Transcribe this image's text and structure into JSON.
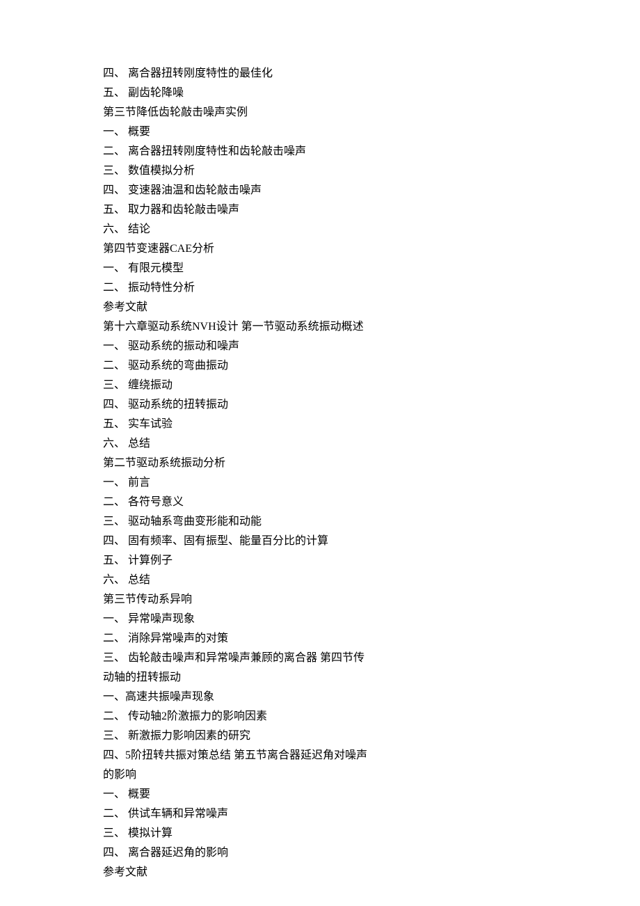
{
  "lines": [
    "四、 离合器扭转刚度特性的最佳化",
    "五、 副齿轮降噪",
    "第三节降低齿轮敲击噪声实例",
    "一、 概要",
    "二、 离合器扭转刚度特性和齿轮敲击噪声",
    "三、 数值模拟分析",
    "四、 变速器油温和齿轮敲击噪声",
    "五、 取力器和齿轮敲击噪声",
    "六、 结论",
    "第四节变速器CAE分析",
    "一、 有限元模型",
    "二、 振动特性分析",
    "参考文献",
    "第十六章驱动系统NVH设计 第一节驱动系统振动概述",
    "一、 驱动系统的振动和噪声",
    "二、 驱动系统的弯曲振动",
    "三、 缠绕振动",
    "四、 驱动系统的扭转振动",
    "五、 实车试验",
    "六、 总结",
    "第二节驱动系统振动分析",
    "一、 前言",
    "二、 各符号意义",
    "三、 驱动轴系弯曲变形能和动能",
    "四、 固有频率、固有振型、能量百分比的计算",
    "五、 计算例子",
    "六、 总结",
    "第三节传动系异响",
    "一、 异常噪声现象",
    "二、 消除异常噪声的对策",
    "三、 齿轮敲击噪声和异常噪声兼顾的离合器 第四节传动轴的扭转振动",
    "一、高速共振噪声现象",
    "二、 传动轴2阶激振力的影响因素",
    "三、 新激振力影响因素的研究",
    "四、5阶扭转共振对策总结 第五节离合器延迟角对噪声的影响",
    "一、 概要",
    "二、 供试车辆和异常噪声",
    "三、 模拟计算",
    "四、 离合器延迟角的影响",
    "参考文献"
  ]
}
